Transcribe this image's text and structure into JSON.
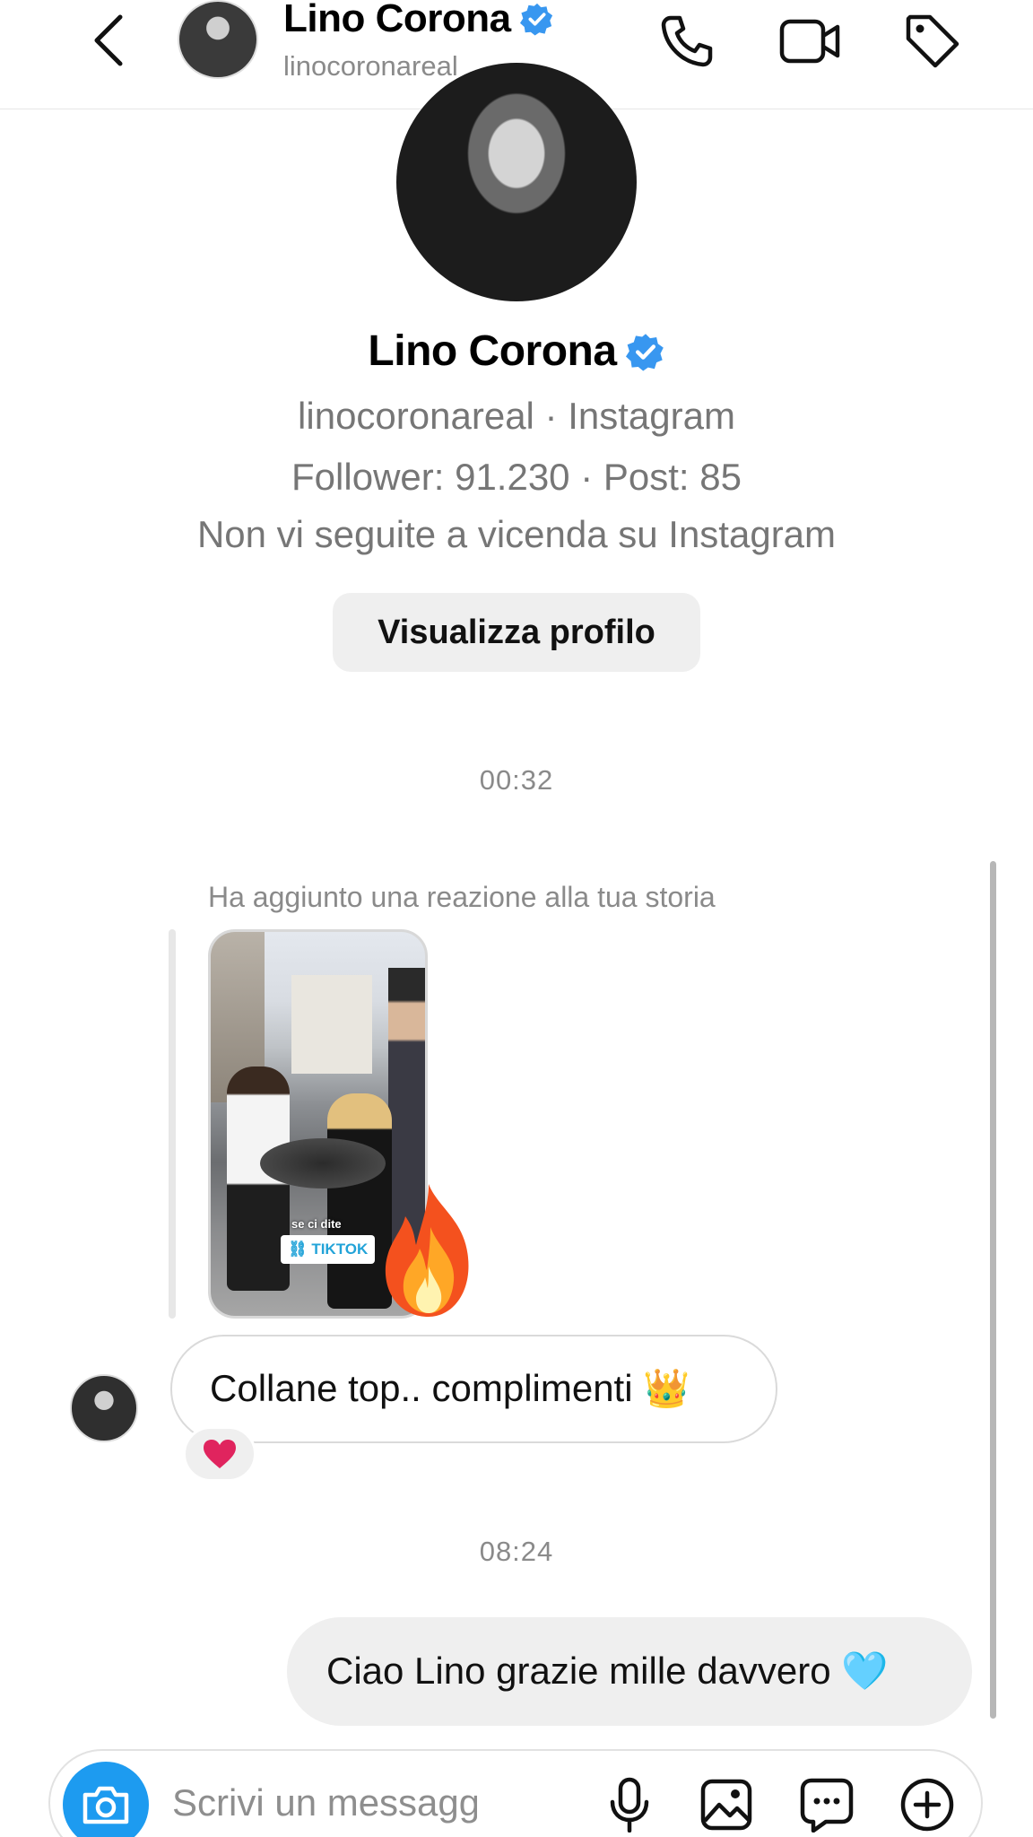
{
  "header": {
    "name": "Lino Corona",
    "username": "linocoronareal",
    "icons": {
      "back": "chevron-left-icon",
      "verified": "verified-badge-icon",
      "call": "phone-icon",
      "video": "video-camera-icon",
      "tag": "tag-icon"
    }
  },
  "profile": {
    "name": "Lino Corona",
    "subtitle": "linocoronareal · Instagram",
    "stats": "Follower: 91.230 · Post: 85",
    "relation": "Non vi seguite a vicenda su Instagram",
    "view_button": "Visualizza profilo"
  },
  "conversation": {
    "timestamp_1": "00:32",
    "story_reaction_caption": "Ha aggiunto una reazione alla tua storia",
    "story_overlay_text": "se ci dite",
    "story_link_label": "TIKTOK",
    "story_reaction_emoji": "fire-emoji",
    "incoming_message": "Collane top.. complimenti 👑",
    "incoming_reaction": "❤️",
    "timestamp_2": "08:24",
    "outgoing_message": "Ciao Lino grazie mille davvero 🩵"
  },
  "composer": {
    "placeholder": "Scrivi un messaggio...",
    "icons": {
      "camera": "camera-icon",
      "microphone": "microphone-icon",
      "gallery": "image-icon",
      "sticker": "chat-bubble-icon",
      "add": "plus-circle-icon"
    }
  },
  "colors": {
    "verified": "#3897f0",
    "camera_button": "#1d9bf0",
    "bubble_outgoing": "#efefef",
    "muted_text": "#767676"
  }
}
